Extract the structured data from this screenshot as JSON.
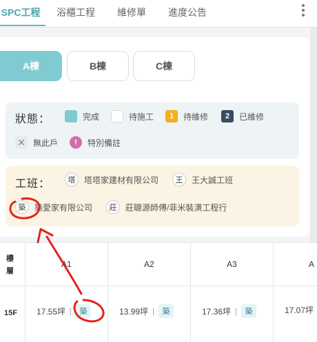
{
  "tabs": [
    {
      "label": "SPC工程",
      "active": true
    },
    {
      "label": "浴櫃工程",
      "active": false
    },
    {
      "label": "維修單",
      "active": false
    },
    {
      "label": "進度公告",
      "active": false
    }
  ],
  "buildings": [
    {
      "label": "A棟",
      "active": true
    },
    {
      "label": "B棟",
      "active": false
    },
    {
      "label": "C棟",
      "active": false
    }
  ],
  "status": {
    "title": "狀態：",
    "legend": [
      {
        "label": "完成",
        "symbol": "",
        "icon": "complete-swatch"
      },
      {
        "label": "待施工",
        "symbol": "",
        "icon": "pending-swatch"
      },
      {
        "label": "待維修",
        "symbol": "1",
        "icon": "repair-count-badge"
      },
      {
        "label": "已維修",
        "symbol": "2",
        "icon": "repaired-count-badge"
      },
      {
        "label": "無此戶",
        "symbol": "✕",
        "icon": "x-icon"
      },
      {
        "label": "特別備註",
        "symbol": "!",
        "icon": "exclamation-icon"
      }
    ],
    "colors": {
      "complete": "#7fcbd1",
      "pending_repair": "#f2b01e",
      "repaired": "#3b4a63",
      "special_note": "#d26ea7"
    }
  },
  "team": {
    "title": "工班：",
    "members": [
      {
        "initial": "塔",
        "name": "塔塔家建材有限公司"
      },
      {
        "initial": "王",
        "name": "王大誠工班"
      },
      {
        "initial": "築",
        "name": "築愛家有限公司"
      },
      {
        "initial": "莊",
        "name": "莊聰源師傅/菲米裝潢工程行"
      }
    ]
  },
  "table": {
    "corner_label": "樓\n層",
    "columns": [
      "A1",
      "A2",
      "A3",
      "A"
    ],
    "rows": [
      {
        "floor": "15F",
        "cells": [
          {
            "area": "17.55坪",
            "team": "築"
          },
          {
            "area": "13.99坪",
            "team": "築"
          },
          {
            "area": "17.36坪",
            "team": "築"
          },
          {
            "area": "17.07坪",
            "team": ""
          }
        ]
      }
    ]
  },
  "theme": {
    "accent": "#5fb7be",
    "annotation": "#e0231b"
  }
}
